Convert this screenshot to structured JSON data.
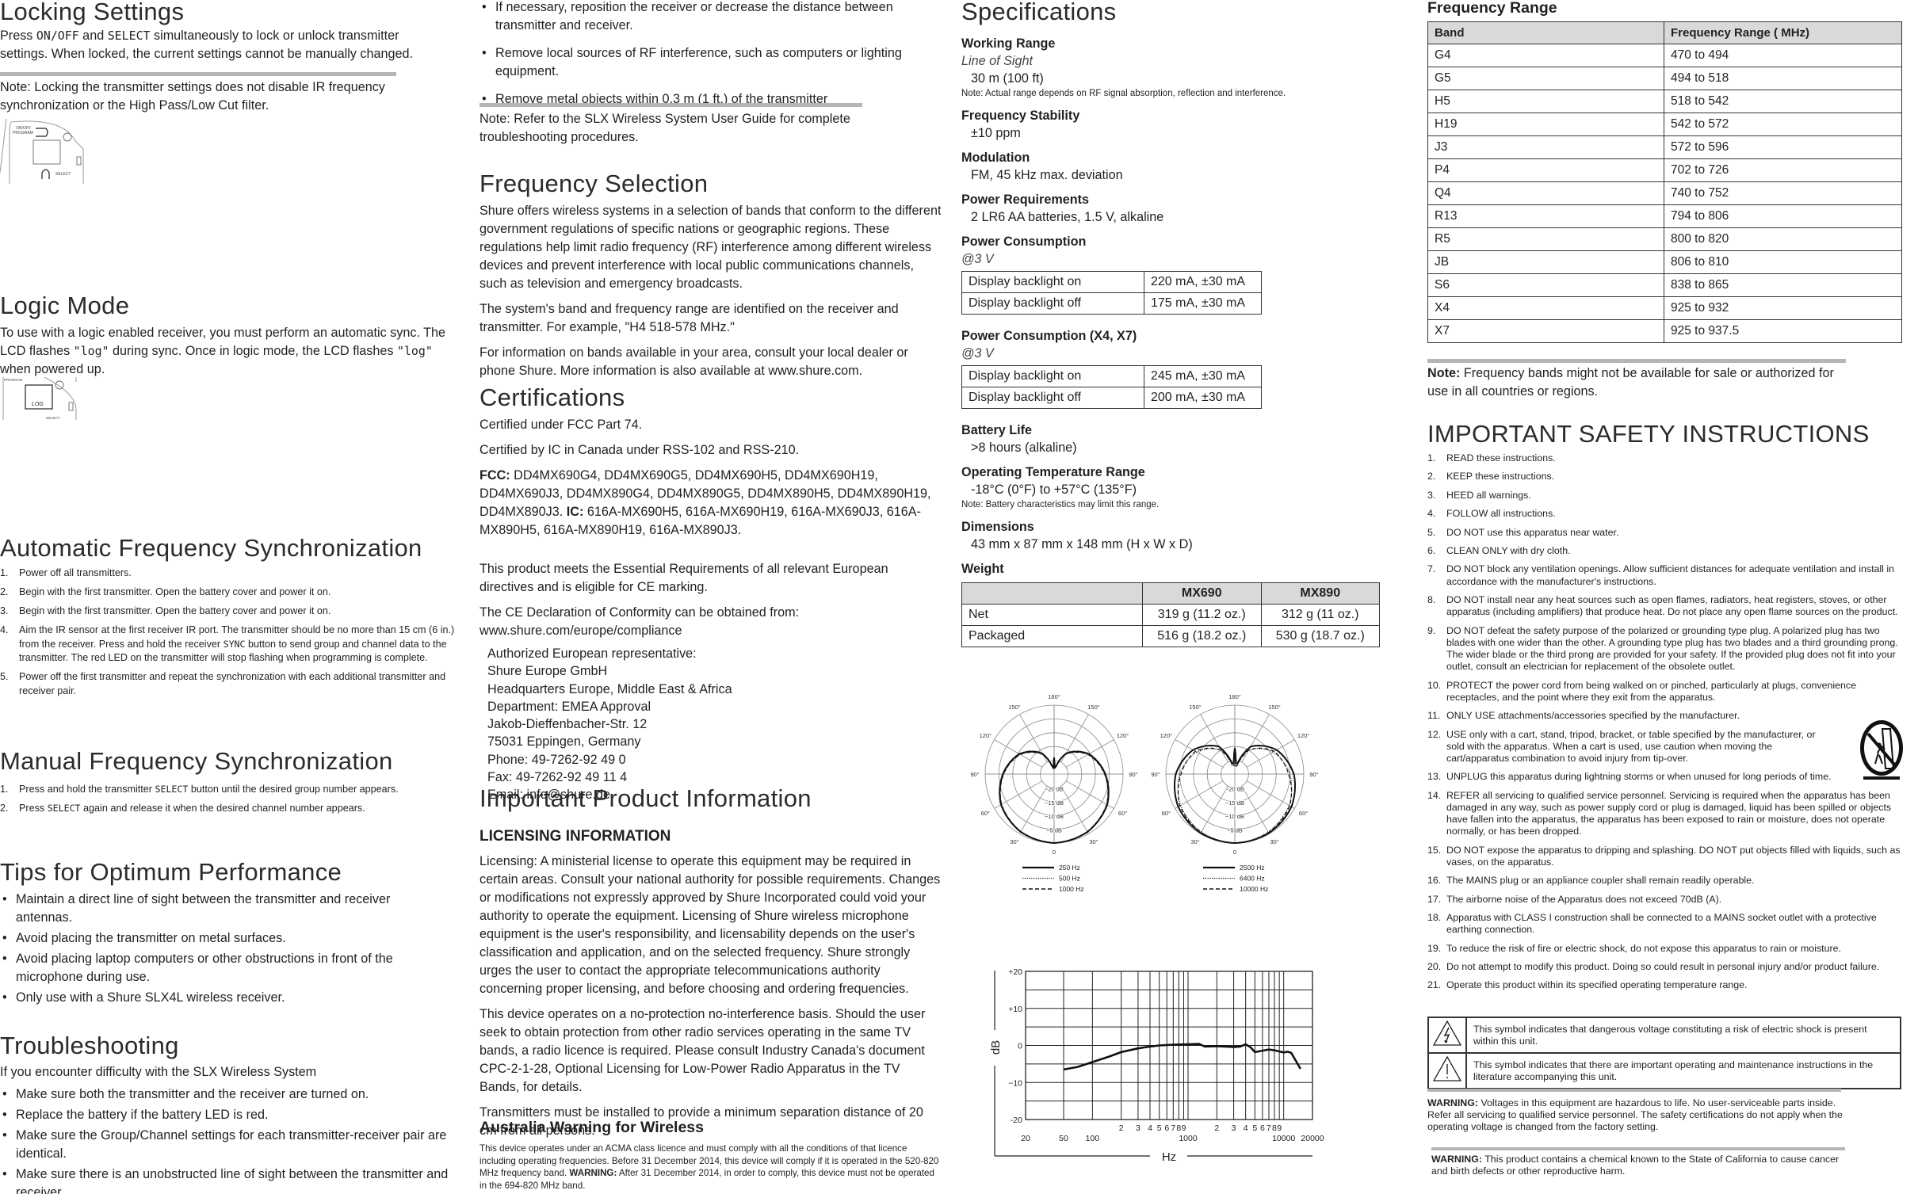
{
  "locking": {
    "title": "Locking Settings",
    "t1": "Press ",
    "k1": "ON/OFF",
    "t2": " and ",
    "k2": "SELECT",
    "t3": " simultaneously to lock or unlock transmitter settings. When locked, the current settings cannot be manually changed.",
    "note": "Note: Locking the transmitter settings does not disable IR frequency synchronization or the High Pass/Low Cut filter.",
    "fig_labels": [
      "ON/OFF",
      "PROGRAM",
      "SELECT"
    ]
  },
  "logic": {
    "title": "Logic Mode",
    "t1": "To use with a logic enabled receiver, you must perform an automatic sync. The LCD flashes ",
    "k1": "\"log\"",
    "t2": " during sync. Once in logic mode, the LCD flashes ",
    "k2": "\"log\"",
    "t3": " when powered up.",
    "fig_labels": [
      "PROGRAM",
      "LOG",
      "SELECT"
    ]
  },
  "afs": {
    "title": "Automatic Frequency Synchronization",
    "steps": [
      "Power off all transmitters.",
      "Begin with the first transmitter. Open the battery cover and power it on.",
      "Begin with the first transmitter. Open the battery cover and power it on."
    ],
    "step4a": "Aim the IR sensor at the first receiver IR port. The transmitter should be no more than 15 cm (6 in.) from the receiver. Press and hold the receiver ",
    "step4k": "SYNC",
    "step4b": " button to send group and channel data to the transmitter. The red LED on the transmitter will stop flashing when programming is complete.",
    "step5": "Power off the first transmitter and repeat the synchronization with each additional transmitter and receiver pair."
  },
  "mfs": {
    "title": "Manual Frequency Synchronization",
    "s1a": "Press and hold the transmitter ",
    "s1k": "SELECT",
    "s1b": " button until the desired group number appears.",
    "s2a": "Press ",
    "s2k": "SELECT",
    "s2b": " again and release it when the desired channel number appears."
  },
  "tips": {
    "title": "Tips for Optimum Performance",
    "items": [
      "Maintain a direct line of sight between the transmitter and receiver antennas.",
      "Avoid placing the transmitter on metal surfaces.",
      "Avoid placing laptop computers or other obstructions in front of the microphone during use.",
      "Only use with a Shure SLX4L wireless receiver."
    ]
  },
  "trouble": {
    "title": "Troubleshooting",
    "intro": "If you encounter difficulty with the SLX Wireless System",
    "items": [
      "Make sure both the transmitter and the receiver are turned on.",
      "Replace the battery if the battery LED is red.",
      "Make sure the Group/Channel settings for each transmitter-receiver pair are identical.",
      "Make sure there is an unobstructed line of sight between the transmitter and receiver.",
      "If necessary, reposition the receiver or decrease the distance between transmitter and receiver.",
      "Remove local sources of RF interference, such as computers or lighting equipment.",
      "Remove metal objects within 0.3 m (1 ft.) of the transmitter"
    ],
    "note": "Note: Refer to the SLX Wireless System User Guide for complete troubleshooting procedures."
  },
  "freqsel": {
    "title": "Frequency Selection",
    "p": [
      "Shure offers wireless systems in a selection of bands that conform to the different government regulations of specific nations or geographic regions. These regulations help limit radio frequency (RF) interference among different wireless devices and prevent interference with local public communications channels, such as television and emergency broadcasts.",
      "The system's band and frequency range are identified on the receiver and transmitter. For example, \"H4 518-578 MHz.\"",
      "For information on bands available in your area, consult your local dealer or phone Shure. More information is also available at www.shure.com."
    ]
  },
  "cert": {
    "title": "Certifications",
    "p1": "Certified under FCC Part 74.",
    "p2": "Certified by IC in Canada under RSS-102 and RSS-210.",
    "fcc_l": "FCC:",
    "fcc": " DD4MX690G4, DD4MX690G5, DD4MX690H5, DD4MX690H19, DD4MX690J3, DD4MX890G4, DD4MX890G5, DD4MX890H5, DD4MX890H19, DD4MX890J3. ",
    "ic_l": "IC:",
    "ic": " 616A-MX690H5, 616A-MX690H19, 616A-MX690J3, 616A-MX890H5, 616A-MX890H19, 616A-MX890J3.",
    "p3": "This product meets the Essential Requirements of all relevant European directives and is eligible for CE marking.",
    "p4": "The CE Declaration of Conformity can be obtained from: www.shure.com/europe/compliance",
    "rep": [
      "Authorized European representative:",
      "Shure Europe GmbH",
      "Headquarters Europe, Middle East & Africa",
      "Department: EMEA Approval",
      "Jakob-Dieffenbacher-Str. 12",
      "75031 Eppingen, Germany",
      "Phone: 49-7262-92 49 0",
      "Fax: 49-7262-92 49 11 4",
      "Email: info@shure.de"
    ]
  },
  "ipi": {
    "title": "Important Product Information",
    "lic_title": "LICENSING INFORMATION",
    "p": [
      "Licensing: A ministerial license to operate this equipment may be required in certain areas. Consult your national authority for possible requirements. Changes or modifications not expressly approved by Shure Incorporated could void your authority to operate the equipment. Licensing of Shure wireless microphone equipment is the user's responsibility, and licensability depends on the user's classification and application, and on the selected frequency. Shure strongly urges the user to contact the appropriate telecommunications authority concerning proper licensing, and before choosing and ordering frequencies.",
      "This device operates on a no-protection no-interference basis. Should the user seek to obtain protection from other radio services operating in the same TV bands, a radio licence is required. Please consult Industry Canada's document CPC-2-1-28, Optional Licensing for Low-Power Radio Apparatus in the TV Bands, for details.",
      "Transmitters must be installed to provide a minimum separation distance of 20 cm from all persons."
    ],
    "aus_title": "Australia Warning for Wireless",
    "aus_a": "This device operates under an ACMA class licence and must comply with all the conditions of that licence including operating frequencies. Before 31 December 2014, this device will comply if it is operated in the 520-820 MHz frequency band. ",
    "aus_w": "WARNING:",
    "aus_b": " After 31 December 2014, in order to comply, this device must not be operated in the 694-820 MHz band."
  },
  "specs": {
    "title": "Specifications",
    "working_range": {
      "label": "Working Range",
      "sub": "Line of Sight",
      "value": "30 m (100 ft)",
      "note": "Note: Actual range depends on RF signal absorption, reflection and interference."
    },
    "stability": {
      "label": "Frequency Stability",
      "value": "±10 ppm"
    },
    "modulation": {
      "label": "Modulation",
      "value": "FM, 45 kHz max. deviation"
    },
    "power_req": {
      "label": "Power Requirements",
      "value": "2 LR6 AA batteries, 1.5 V, alkaline"
    },
    "power_cons": {
      "label": "Power Consumption",
      "sub": "@3 V",
      "rows": [
        [
          "Display backlight on",
          "220 mA, ±30 mA"
        ],
        [
          "Display backlight off",
          "175 mA, ±30 mA"
        ]
      ]
    },
    "power_cons2": {
      "label": "Power Consumption (X4, X7)",
      "sub": "@3 V",
      "rows": [
        [
          "Display backlight on",
          "245 mA, ±30 mA"
        ],
        [
          "Display backlight off",
          "200 mA, ±30 mA"
        ]
      ]
    },
    "battery": {
      "label": "Battery Life",
      "value": ">8 hours (alkaline)"
    },
    "temp": {
      "label": "Operating Temperature Range",
      "value": "-18°C (0°F) to +57°C (135°F)",
      "note": "Note: Battery characteristics may limit this range."
    },
    "dims": {
      "label": "Dimensions",
      "value": "43 mm x 87 mm x 148 mm (H x W x D)"
    },
    "weight": {
      "label": "Weight",
      "headers": [
        "",
        "MX690",
        "MX890"
      ],
      "rows": [
        [
          "Net",
          "319 g (11.2 oz.)",
          "312 g (11 oz.)"
        ],
        [
          "Packaged",
          "516 g (18.2 oz.)",
          "530 g (18.7 oz.)"
        ]
      ]
    }
  },
  "chart_data": [
    {
      "type": "line",
      "xlabel": "Hz",
      "ylabel": "dB",
      "xscale": "log",
      "xlim": [
        20,
        20000
      ],
      "ylim": [
        -20,
        20
      ],
      "grid": true,
      "ytick_labels": [
        "+20",
        "+10",
        "0",
        "−10",
        "-20"
      ],
      "yticks": [
        20,
        10,
        0,
        -10,
        -20
      ],
      "xtick_labels": [
        "20",
        "50",
        "100",
        "1000",
        "10000",
        "20000"
      ],
      "xticks": [
        20,
        50,
        100,
        1000,
        10000,
        20000
      ],
      "minor_labels": [
        "2",
        "3",
        "4",
        "5",
        "6",
        "7",
        "8",
        "9"
      ],
      "x": [
        50,
        70,
        100,
        150,
        200,
        300,
        400,
        500,
        700,
        1000,
        1300,
        1500,
        2000,
        3000,
        3500,
        4000,
        4500,
        5000,
        7000,
        8000,
        10000,
        11000,
        12000,
        15000
      ],
      "y": [
        -6.5,
        -5.8,
        -4.5,
        -3,
        -1.8,
        -0.8,
        -0.3,
        0,
        0.2,
        0.3,
        0.4,
        -0.3,
        -0.2,
        -0.4,
        -0.3,
        0.3,
        -0.5,
        -1.8,
        -1.1,
        -1.3,
        -1.9,
        -1.7,
        -2,
        -6.3
      ]
    },
    {
      "type": "polar",
      "angle_labels": [
        "180°",
        "150°",
        "120°",
        "90°",
        "60°",
        "30°",
        "0"
      ],
      "ring_labels": [
        "−20 dB",
        "−15 dB",
        "−10 dB",
        "−5 dB"
      ],
      "rlim_db": [
        -25,
        0
      ],
      "angles": [
        0,
        30,
        60,
        90,
        120,
        150,
        165,
        175,
        180
      ],
      "series": [
        {
          "name": "250 Hz",
          "style": "solid",
          "db": [
            0,
            -0.8,
            -2.8,
            -6.5,
            -10.5,
            -16.5,
            -22,
            -23,
            -19
          ]
        },
        {
          "name": "500 Hz",
          "style": "dotted",
          "db": [
            0,
            -0.7,
            -2.6,
            -6.2,
            -10.2,
            -16,
            -21.5,
            -23,
            -19.5
          ]
        },
        {
          "name": "1000 Hz",
          "style": "dashed",
          "db": [
            0,
            -0.9,
            -3,
            -6.7,
            -10.8,
            -16.8,
            -22,
            -23,
            -20
          ]
        }
      ]
    },
    {
      "type": "polar",
      "angle_labels": [
        "180°",
        "150°",
        "120°",
        "90°",
        "60°",
        "30°",
        "0"
      ],
      "ring_labels": [
        "−20 dB",
        "−15 dB",
        "−10 dB",
        "−5 dB"
      ],
      "rlim_db": [
        -25,
        0
      ],
      "angles": [
        0,
        30,
        60,
        90,
        120,
        150,
        165,
        175,
        180
      ],
      "series": [
        {
          "name": "2500 Hz",
          "style": "solid",
          "db": [
            0,
            -0.3,
            -1.3,
            -3.6,
            -7.5,
            -13.5,
            -21,
            -21,
            -15.5
          ]
        },
        {
          "name": "6400 Hz",
          "style": "dotted",
          "db": [
            0,
            -0.8,
            -2.3,
            -5,
            -9,
            -15,
            -22,
            -22,
            -17
          ]
        },
        {
          "name": "10000 Hz",
          "style": "dashed",
          "db": [
            0,
            -0.5,
            -2,
            -5.5,
            -8.5,
            -15,
            -22,
            -22,
            -16
          ]
        }
      ]
    }
  ],
  "freqrange": {
    "title": "Frequency Range",
    "headers": [
      "Band",
      "Frequency Range ( MHz)"
    ],
    "rows": [
      [
        "G4",
        "470 to 494"
      ],
      [
        "G5",
        "494 to 518"
      ],
      [
        "H5",
        "518 to 542"
      ],
      [
        "H19",
        "542 to 572"
      ],
      [
        "J3",
        "572 to 596"
      ],
      [
        "P4",
        "702 to 726"
      ],
      [
        "Q4",
        "740 to 752"
      ],
      [
        "R13",
        "794 to 806"
      ],
      [
        "R5",
        "800 to 820"
      ],
      [
        "JB",
        "806 to 810"
      ],
      [
        "S6",
        "838 to 865"
      ],
      [
        "X4",
        "925 to 932"
      ],
      [
        "X7",
        "925 to 937.5"
      ]
    ],
    "note_l": "Note:",
    "note": " Frequency bands might not be available for sale or authorized for use in all countries or regions."
  },
  "safety": {
    "title": "IMPORTANT SAFETY INSTRUCTIONS",
    "items": [
      "READ these instructions.",
      "KEEP these instructions.",
      "HEED all warnings.",
      "FOLLOW all instructions.",
      "DO NOT use this apparatus near water.",
      "CLEAN ONLY with dry cloth.",
      "DO NOT block any ventilation openings. Allow sufficient distances for adequate ventilation and install in accordance with the manufacturer's instructions.",
      "DO NOT install near any heat sources such as open flames, radiators, heat registers, stoves, or other apparatus (including amplifiers) that produce heat. Do not place any open flame sources on the product.",
      "DO NOT defeat the safety purpose of the polarized or grounding type plug. A polarized plug has two blades with one wider than the other. A grounding type plug has two blades and a third grounding prong. The wider blade or the third prong are provided for your safety. If the provided plug does not fit into your outlet, consult an electrician for replacement of the obsolete outlet.",
      "PROTECT the power cord from being walked on or pinched, particularly at plugs, convenience receptacles, and the point where they exit from the apparatus.",
      "ONLY USE attachments/accessories specified by the manufacturer.",
      "USE only with a cart, stand, tripod, bracket, or table specified by the manufacturer, or sold with the apparatus. When a cart is used, use caution when moving the cart/apparatus combination to avoid injury from tip-over.",
      "UNPLUG this apparatus during lightning storms or when unused for long periods of time.",
      "REFER all servicing to qualified service personnel. Servicing is required when the apparatus has been damaged in any way, such as power supply cord or plug is damaged, liquid has been spilled or objects have fallen into the apparatus, the apparatus has been exposed to rain or moisture, does not operate normally, or has been dropped.",
      "DO NOT expose the apparatus to dripping and splashing. DO NOT put objects filled with liquids, such as vases, on the apparatus.",
      "The MAINS plug or an appliance coupler shall remain readily operable.",
      "The airborne noise of the Apparatus does not exceed 70dB (A).",
      "Apparatus with CLASS I construction shall be connected to a MAINS socket outlet with a protective earthing connection.",
      "To reduce the risk of fire or electric shock, do not expose this apparatus to rain or moisture.",
      "Do not attempt to modify this product. Doing so could result in personal injury and/or product failure.",
      "Operate this product within its specified operating temperature range."
    ],
    "sym1": "This symbol indicates that dangerous voltage constituting a risk of electric shock is present within this unit.",
    "sym2": "This symbol indicates that there are important operating and maintenance instructions in the literature accompanying this unit.",
    "w_l": "WARNING:",
    "w1": " Voltages in this equipment are hazardous to life. No user-serviceable parts inside. Refer all servicing to qualified service personnel. The safety certifications do not apply when the operating voltage is changed from the factory setting.",
    "w2": " This product contains a chemical known to the State of California to cause cancer and birth defects or other reproductive harm."
  }
}
